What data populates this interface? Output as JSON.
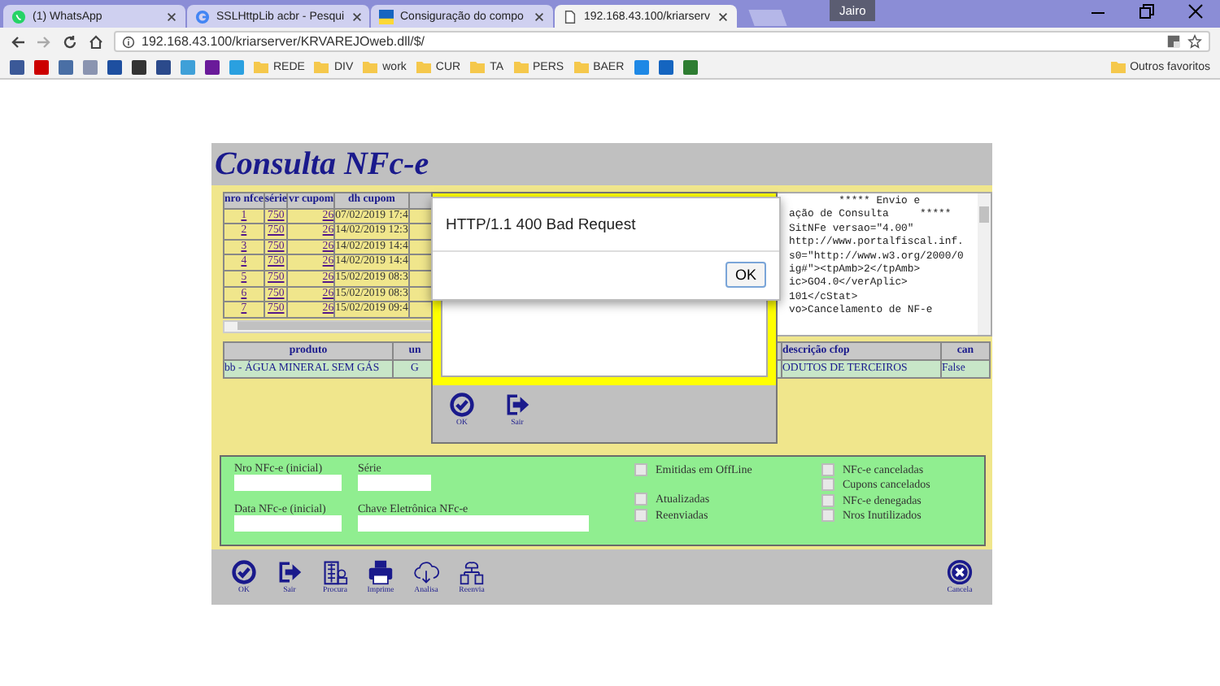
{
  "browser": {
    "tabs": [
      {
        "title": "(1) WhatsApp",
        "kind": "whatsapp",
        "selected": false
      },
      {
        "title": "SSLHttpLib acbr - Pesqui",
        "kind": "google",
        "selected": false
      },
      {
        "title": "Consiguração do compo",
        "kind": "ac",
        "selected": false
      },
      {
        "title": "192.168.43.100/kriarserv",
        "kind": "page",
        "selected": true
      }
    ],
    "profile": "Jairo",
    "address": "192.168.43.100/kriarserver/KRVAREJOweb.dll/$/",
    "bookmarks": [
      {
        "kind": "site",
        "color": "#3b5998"
      },
      {
        "kind": "site",
        "color": "#cc0000"
      },
      {
        "kind": "site",
        "color": "#4a6fa5"
      },
      {
        "kind": "site",
        "color": "#8a94b0"
      },
      {
        "kind": "site",
        "color": "#1e4fa0"
      },
      {
        "kind": "site",
        "color": "#333333"
      },
      {
        "kind": "site",
        "color": "#2b4a8b"
      },
      {
        "kind": "site",
        "color": "#3fa0d8"
      },
      {
        "kind": "site",
        "color": "#6a1b9a"
      },
      {
        "kind": "site",
        "color": "#2aa0e0"
      },
      {
        "kind": "folder",
        "label": "REDE"
      },
      {
        "kind": "folder",
        "label": "DIV"
      },
      {
        "kind": "folder",
        "label": "work"
      },
      {
        "kind": "folder",
        "label": "CUR"
      },
      {
        "kind": "folder",
        "label": "TA"
      },
      {
        "kind": "folder",
        "label": "PERS"
      },
      {
        "kind": "folder",
        "label": "BAER"
      },
      {
        "kind": "site",
        "color": "#1e88e5"
      },
      {
        "kind": "site",
        "color": "#1565c0"
      },
      {
        "kind": "site",
        "color": "#2e7d32"
      }
    ],
    "other_bookmarks": "Outros favoritos"
  },
  "app": {
    "title": "Consulta NFc-e",
    "grid": {
      "columns": [
        "nro nfce",
        "série",
        "vr cupom",
        "dh cupom"
      ],
      "rows": [
        [
          "1",
          "750",
          "26",
          "07/02/2019 17:4"
        ],
        [
          "2",
          "750",
          "26",
          "14/02/2019 12:3"
        ],
        [
          "3",
          "750",
          "26",
          "14/02/2019 14:4"
        ],
        [
          "4",
          "750",
          "26",
          "14/02/2019 14:4"
        ],
        [
          "5",
          "750",
          "26",
          "15/02/2019 08:3"
        ],
        [
          "6",
          "750",
          "26",
          "15/02/2019 08:3"
        ],
        [
          "7",
          "750",
          "26",
          "15/02/2019 09:4"
        ]
      ]
    },
    "xml_lines": [
      "        ***** Envio e",
      "ação de Consulta     *****",
      "SitNFe versao=\"4.00\"",
      "http://www.portalfiscal.inf.",
      "s0=\"http://www.w3.org/2000/0",
      "ig#\"><tpAmb>2</tpAmb>",
      "ic>GO4.0</verAplic>",
      "101</cStat>",
      "vo>Cancelamento de NF-e"
    ],
    "products": {
      "columns": [
        "produto",
        "un",
        "descrição cfop",
        "can"
      ],
      "rows": [
        [
          "bb - ÁGUA MINERAL SEM GÁS",
          "G",
          "ODUTOS DE TERCEIROS",
          "False"
        ]
      ]
    },
    "filters": {
      "fields": [
        {
          "label": "Nro NFc-e (inicial)"
        },
        {
          "label": "Série"
        },
        {
          "label": "Data NFc-e (inicial)"
        },
        {
          "label": "Chave Eletrônica NFc-e"
        }
      ],
      "checkbox_columns": [
        [
          {
            "label": "Emitidas em OffLine",
            "checked": false
          },
          {
            "label": "Atualizadas",
            "checked": false
          },
          {
            "label": "Reenviadas",
            "checked": false
          }
        ],
        [
          {
            "label": "NFc-e canceladas",
            "checked": false
          },
          {
            "label": "Cupons cancelados",
            "checked": false
          },
          {
            "label": "NFc-e denegadas",
            "checked": false
          },
          {
            "label": "Nros Inutilizados",
            "checked": false
          }
        ]
      ]
    },
    "toolbar": [
      {
        "label": "OK",
        "kind": "check"
      },
      {
        "label": "Sair",
        "kind": "exit"
      },
      {
        "label": "Procura",
        "kind": "building"
      },
      {
        "label": "Imprime",
        "kind": "printer"
      },
      {
        "label": "Analisa",
        "kind": "cloud"
      },
      {
        "label": "Reenvia",
        "kind": "network"
      }
    ],
    "toolbar_right": [
      {
        "label": "Cancela",
        "kind": "cancel"
      }
    ]
  },
  "popup": {
    "buttons": [
      {
        "label": "OK",
        "kind": "check"
      },
      {
        "label": "Sair",
        "kind": "exit"
      }
    ]
  },
  "alert": {
    "message": "HTTP/1.1 400 Bad Request",
    "button": "OK"
  }
}
